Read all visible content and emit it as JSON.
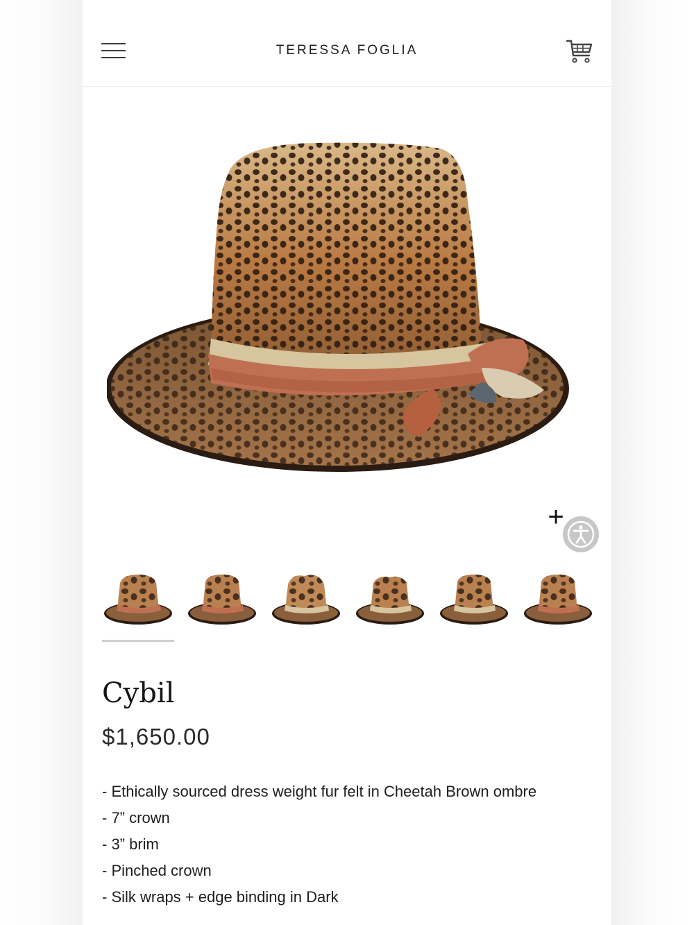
{
  "header": {
    "brand": "TERESSA FOGLIA",
    "menu_icon": "hamburger-menu-icon",
    "cart_icon": "shopping-cart-icon"
  },
  "product": {
    "main_image": "cheetah-print-fedora-hat-photo",
    "thumbnail_count": 6,
    "selected_thumbnail": 1,
    "title": "Cybil",
    "price": "$1,650.00",
    "description": [
      "- Ethically sourced dress weight fur felt in Cheetah Brown ombre",
      "- 7” crown",
      "- 3” brim",
      "- Pinched crown",
      "- Silk wraps + edge binding in Dark"
    ]
  },
  "controls": {
    "plus_label": "+",
    "accessibility_icon": "accessibility-person-icon"
  },
  "colors": {
    "text": "#1c1c1c",
    "border": "#ececec",
    "cheetah_base": "#a8703f",
    "spot": "#2e1c10",
    "band": "#c07052",
    "accessibility_bg": "#c7c7c7"
  }
}
